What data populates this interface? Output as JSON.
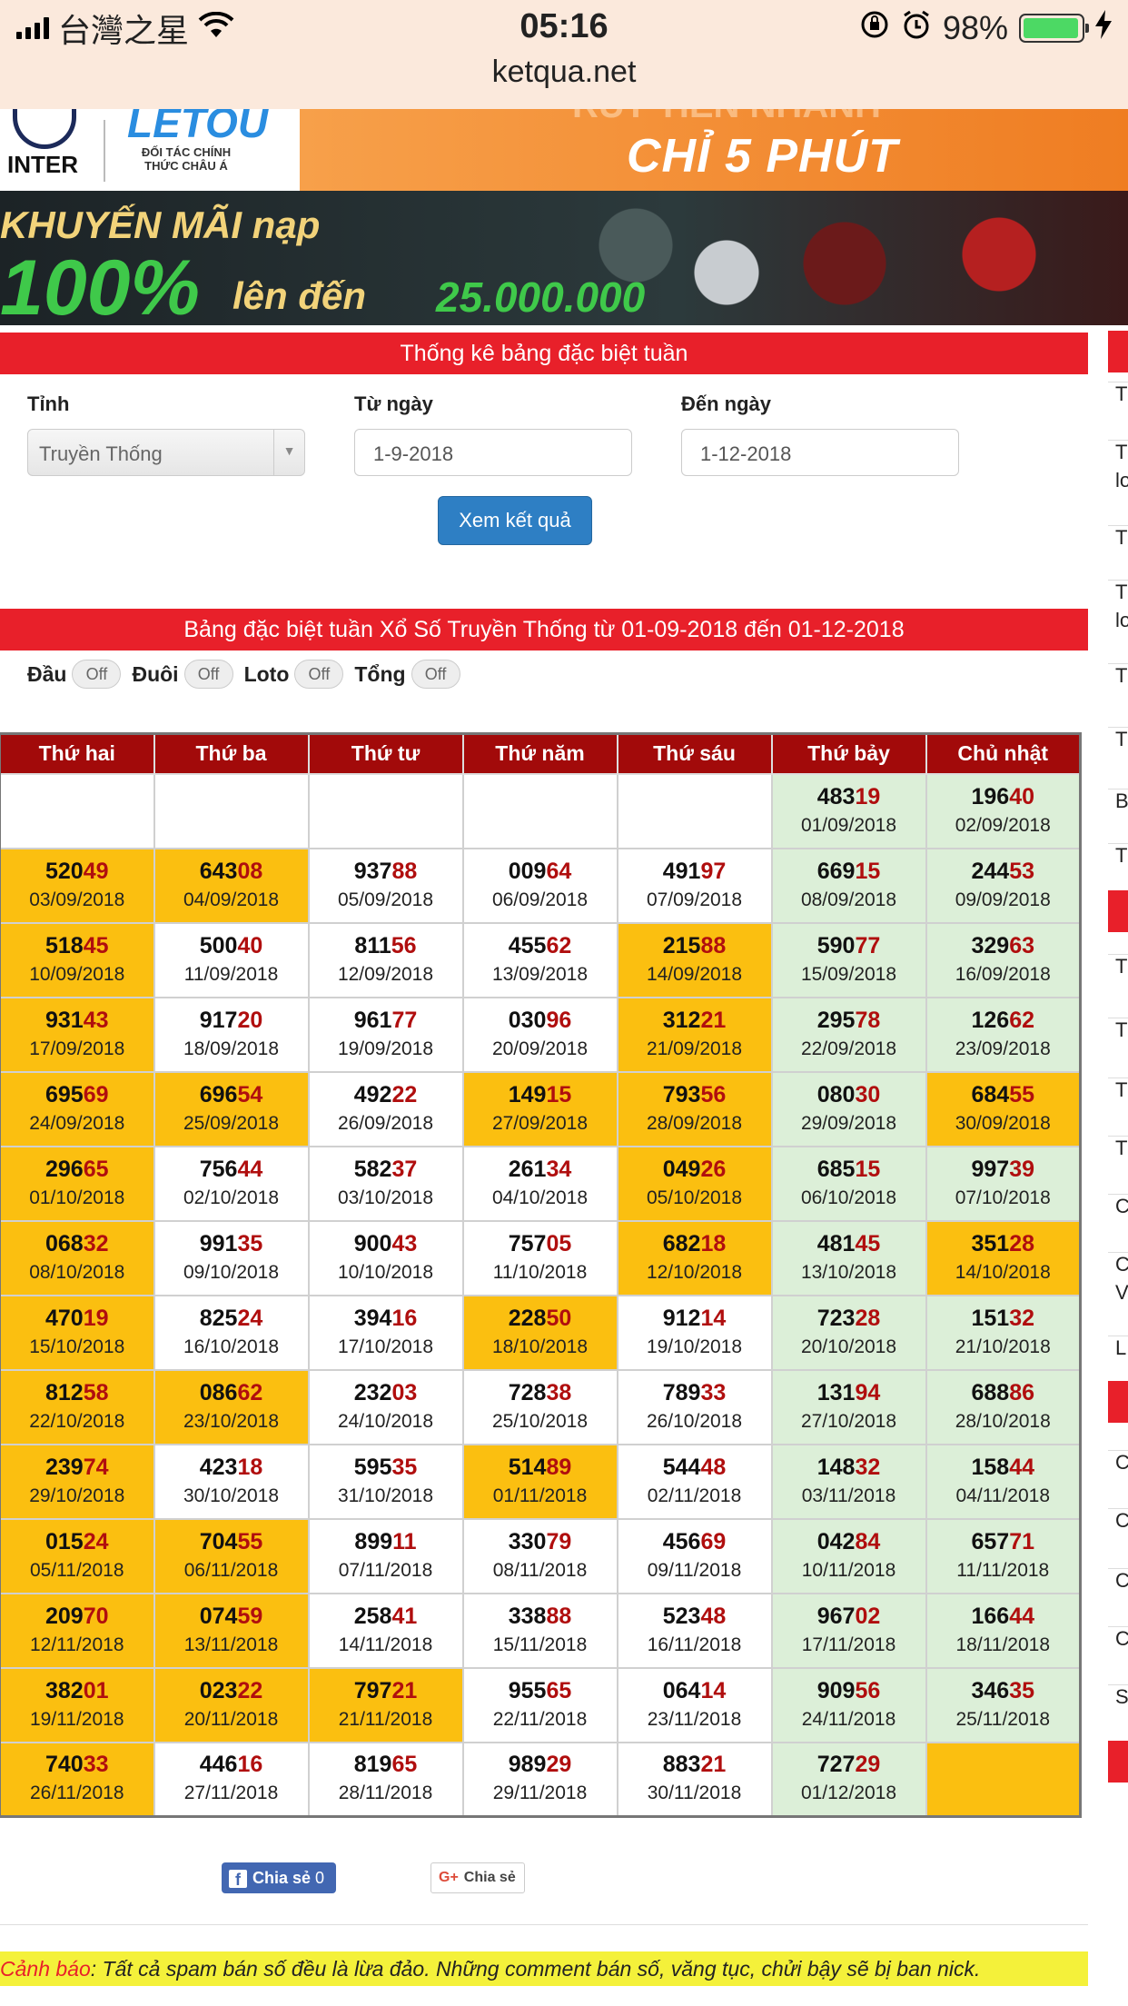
{
  "status_bar": {
    "carrier": "台灣之星",
    "time": "05:16",
    "battery": "98%",
    "url": "ketqua.net"
  },
  "banner_top": {
    "club": "INTER",
    "brand": "LETOU",
    "partner": "ĐỐI TÁC CHÍNH THỨC CHÂU Á",
    "cta_top": "RÚT TIỀN NHANH",
    "cta": "CHỈ 5 PHÚT"
  },
  "banner_promo": {
    "line1": "KHUYẾN MÃI nạp",
    "big": "100%",
    "line2": "lên đến",
    "amount": "25.000.000"
  },
  "filter_panel": {
    "title": "Thống kê bảng đặc biệt tuần",
    "province_label": "Tỉnh",
    "province_value": "Truyền Thống",
    "from_label": "Từ ngày",
    "from_value": "1-9-2018",
    "to_label": "Đến ngày",
    "to_value": "1-12-2018",
    "submit_label": "Xem kết quả"
  },
  "results_panel": {
    "title": "Bảng đặc biệt tuần Xổ Số Truyền Thống từ 01-09-2018 đến 01-12-2018",
    "toggles": [
      {
        "label": "Đầu",
        "state": "Off"
      },
      {
        "label": "Đuôi",
        "state": "Off"
      },
      {
        "label": "Loto",
        "state": "Off"
      },
      {
        "label": "Tổng",
        "state": "Off"
      }
    ],
    "days": [
      "Thứ hai",
      "Thứ ba",
      "Thứ tư",
      "Thứ năm",
      "Thứ sáu",
      "Thứ bảy",
      "Chủ nhật"
    ],
    "weeks": [
      [
        null,
        null,
        null,
        null,
        null,
        {
          "h": "483",
          "t": "19",
          "d": "01/09/2018"
        },
        {
          "h": "196",
          "t": "40",
          "d": "02/09/2018"
        }
      ],
      [
        {
          "h": "520",
          "t": "49",
          "d": "03/09/2018",
          "hl": true
        },
        {
          "h": "643",
          "t": "08",
          "d": "04/09/2018",
          "hl": true
        },
        {
          "h": "937",
          "t": "88",
          "d": "05/09/2018"
        },
        {
          "h": "009",
          "t": "64",
          "d": "06/09/2018"
        },
        {
          "h": "491",
          "t": "97",
          "d": "07/09/2018"
        },
        {
          "h": "669",
          "t": "15",
          "d": "08/09/2018"
        },
        {
          "h": "244",
          "t": "53",
          "d": "09/09/2018"
        }
      ],
      [
        {
          "h": "518",
          "t": "45",
          "d": "10/09/2018",
          "hl": true
        },
        {
          "h": "500",
          "t": "40",
          "d": "11/09/2018"
        },
        {
          "h": "811",
          "t": "56",
          "d": "12/09/2018"
        },
        {
          "h": "455",
          "t": "62",
          "d": "13/09/2018"
        },
        {
          "h": "215",
          "t": "88",
          "d": "14/09/2018",
          "hl": true
        },
        {
          "h": "590",
          "t": "77",
          "d": "15/09/2018"
        },
        {
          "h": "329",
          "t": "63",
          "d": "16/09/2018"
        }
      ],
      [
        {
          "h": "931",
          "t": "43",
          "d": "17/09/2018",
          "hl": true
        },
        {
          "h": "917",
          "t": "20",
          "d": "18/09/2018"
        },
        {
          "h": "961",
          "t": "77",
          "d": "19/09/2018"
        },
        {
          "h": "030",
          "t": "96",
          "d": "20/09/2018"
        },
        {
          "h": "312",
          "t": "21",
          "d": "21/09/2018",
          "hl": true
        },
        {
          "h": "295",
          "t": "78",
          "d": "22/09/2018"
        },
        {
          "h": "126",
          "t": "62",
          "d": "23/09/2018"
        }
      ],
      [
        {
          "h": "695",
          "t": "69",
          "d": "24/09/2018",
          "hl": true
        },
        {
          "h": "696",
          "t": "54",
          "d": "25/09/2018",
          "hl": true
        },
        {
          "h": "492",
          "t": "22",
          "d": "26/09/2018"
        },
        {
          "h": "149",
          "t": "15",
          "d": "27/09/2018",
          "hl": true
        },
        {
          "h": "793",
          "t": "56",
          "d": "28/09/2018",
          "hl": true
        },
        {
          "h": "080",
          "t": "30",
          "d": "29/09/2018"
        },
        {
          "h": "684",
          "t": "55",
          "d": "30/09/2018",
          "hl": true
        }
      ],
      [
        {
          "h": "296",
          "t": "65",
          "d": "01/10/2018",
          "hl": true
        },
        {
          "h": "756",
          "t": "44",
          "d": "02/10/2018"
        },
        {
          "h": "582",
          "t": "37",
          "d": "03/10/2018"
        },
        {
          "h": "261",
          "t": "34",
          "d": "04/10/2018"
        },
        {
          "h": "049",
          "t": "26",
          "d": "05/10/2018",
          "hl": true
        },
        {
          "h": "685",
          "t": "15",
          "d": "06/10/2018"
        },
        {
          "h": "997",
          "t": "39",
          "d": "07/10/2018"
        }
      ],
      [
        {
          "h": "068",
          "t": "32",
          "d": "08/10/2018",
          "hl": true
        },
        {
          "h": "991",
          "t": "35",
          "d": "09/10/2018"
        },
        {
          "h": "900",
          "t": "43",
          "d": "10/10/2018"
        },
        {
          "h": "757",
          "t": "05",
          "d": "11/10/2018"
        },
        {
          "h": "682",
          "t": "18",
          "d": "12/10/2018",
          "hl": true
        },
        {
          "h": "481",
          "t": "45",
          "d": "13/10/2018"
        },
        {
          "h": "351",
          "t": "28",
          "d": "14/10/2018",
          "hl": true
        }
      ],
      [
        {
          "h": "470",
          "t": "19",
          "d": "15/10/2018",
          "hl": true
        },
        {
          "h": "825",
          "t": "24",
          "d": "16/10/2018"
        },
        {
          "h": "394",
          "t": "16",
          "d": "17/10/2018"
        },
        {
          "h": "228",
          "t": "50",
          "d": "18/10/2018",
          "hl": true
        },
        {
          "h": "912",
          "t": "14",
          "d": "19/10/2018"
        },
        {
          "h": "723",
          "t": "28",
          "d": "20/10/2018"
        },
        {
          "h": "151",
          "t": "32",
          "d": "21/10/2018"
        }
      ],
      [
        {
          "h": "812",
          "t": "58",
          "d": "22/10/2018",
          "hl": true
        },
        {
          "h": "086",
          "t": "62",
          "d": "23/10/2018",
          "hl": true
        },
        {
          "h": "232",
          "t": "03",
          "d": "24/10/2018"
        },
        {
          "h": "728",
          "t": "38",
          "d": "25/10/2018"
        },
        {
          "h": "789",
          "t": "33",
          "d": "26/10/2018"
        },
        {
          "h": "131",
          "t": "94",
          "d": "27/10/2018"
        },
        {
          "h": "688",
          "t": "86",
          "d": "28/10/2018"
        }
      ],
      [
        {
          "h": "239",
          "t": "74",
          "d": "29/10/2018",
          "hl": true
        },
        {
          "h": "423",
          "t": "18",
          "d": "30/10/2018"
        },
        {
          "h": "595",
          "t": "35",
          "d": "31/10/2018"
        },
        {
          "h": "514",
          "t": "89",
          "d": "01/11/2018",
          "hl": true
        },
        {
          "h": "544",
          "t": "48",
          "d": "02/11/2018"
        },
        {
          "h": "148",
          "t": "32",
          "d": "03/11/2018"
        },
        {
          "h": "158",
          "t": "44",
          "d": "04/11/2018"
        }
      ],
      [
        {
          "h": "015",
          "t": "24",
          "d": "05/11/2018",
          "hl": true
        },
        {
          "h": "704",
          "t": "55",
          "d": "06/11/2018",
          "hl": true
        },
        {
          "h": "899",
          "t": "11",
          "d": "07/11/2018"
        },
        {
          "h": "330",
          "t": "79",
          "d": "08/11/2018"
        },
        {
          "h": "456",
          "t": "69",
          "d": "09/11/2018"
        },
        {
          "h": "042",
          "t": "84",
          "d": "10/11/2018"
        },
        {
          "h": "657",
          "t": "71",
          "d": "11/11/2018"
        }
      ],
      [
        {
          "h": "209",
          "t": "70",
          "d": "12/11/2018",
          "hl": true
        },
        {
          "h": "074",
          "t": "59",
          "d": "13/11/2018",
          "hl": true
        },
        {
          "h": "258",
          "t": "41",
          "d": "14/11/2018"
        },
        {
          "h": "338",
          "t": "88",
          "d": "15/11/2018"
        },
        {
          "h": "523",
          "t": "48",
          "d": "16/11/2018"
        },
        {
          "h": "967",
          "t": "02",
          "d": "17/11/2018"
        },
        {
          "h": "166",
          "t": "44",
          "d": "18/11/2018"
        }
      ],
      [
        {
          "h": "382",
          "t": "01",
          "d": "19/11/2018",
          "hl": true
        },
        {
          "h": "023",
          "t": "22",
          "d": "20/11/2018",
          "hl": true
        },
        {
          "h": "797",
          "t": "21",
          "d": "21/11/2018",
          "hl": true
        },
        {
          "h": "955",
          "t": "65",
          "d": "22/11/2018"
        },
        {
          "h": "064",
          "t": "14",
          "d": "23/11/2018"
        },
        {
          "h": "909",
          "t": "56",
          "d": "24/11/2018"
        },
        {
          "h": "346",
          "t": "35",
          "d": "25/11/2018"
        }
      ],
      [
        {
          "h": "740",
          "t": "33",
          "d": "26/11/2018",
          "hl": true
        },
        {
          "h": "446",
          "t": "16",
          "d": "27/11/2018"
        },
        {
          "h": "819",
          "t": "65",
          "d": "28/11/2018"
        },
        {
          "h": "989",
          "t": "29",
          "d": "29/11/2018"
        },
        {
          "h": "883",
          "t": "21",
          "d": "30/11/2018"
        },
        {
          "h": "727",
          "t": "29",
          "d": "01/12/2018"
        },
        {
          "empty": true,
          "hl": true
        }
      ]
    ]
  },
  "share": {
    "facebook_label": "Chia sẻ",
    "facebook_count": "0",
    "google_label": "Chia sẻ"
  },
  "warning": {
    "label": "Cảnh báo",
    "text": ": Tất cả spam bán số đều là lừa đảo. Những comment bán số, văng tục, chửi bậy sẽ bị ban nick."
  },
  "sidebar_fragments": [
    "T",
    "T",
    "lo",
    "T",
    "T",
    "lo",
    "T",
    "T",
    "B",
    "T",
    "T",
    "T",
    "T",
    "T",
    "C",
    "C",
    "V",
    "L",
    "C",
    "C",
    "C",
    "C",
    "S"
  ],
  "colors": {
    "header_red": "#e8202a",
    "table_header": "#a20a0a",
    "highlight": "#fbbf10",
    "weekend": "#dcefd8",
    "button_blue": "#2e7fc4"
  }
}
